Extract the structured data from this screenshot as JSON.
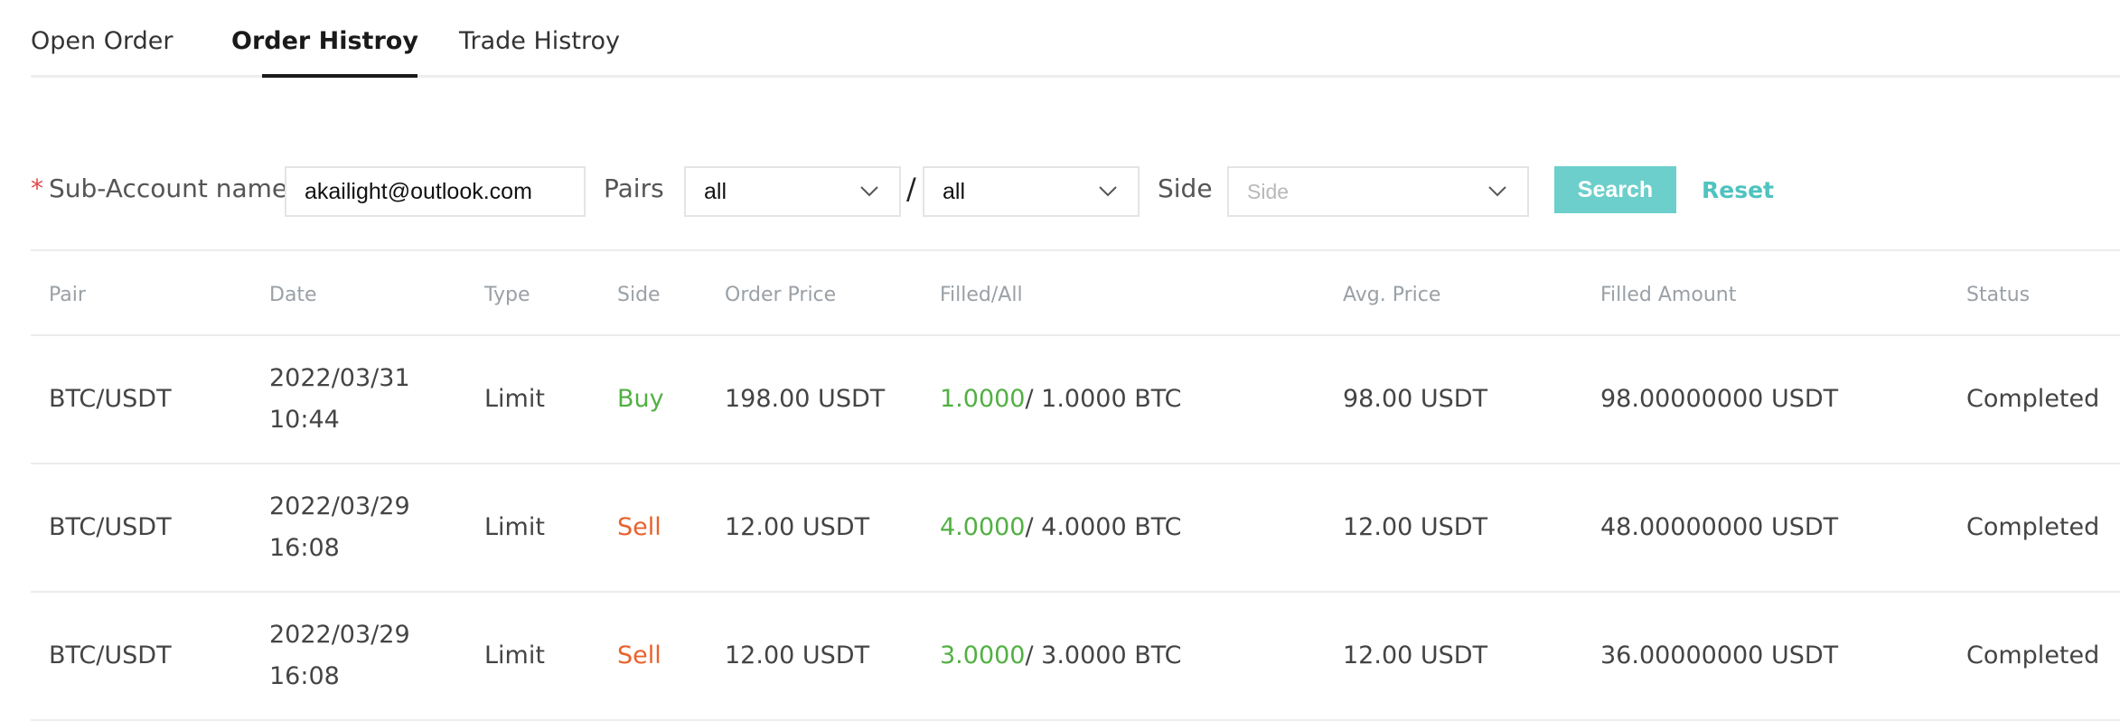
{
  "tabs": [
    {
      "label": "Open Order"
    },
    {
      "label": "Order Histroy"
    },
    {
      "label": "Trade Histroy"
    }
  ],
  "filter": {
    "required_mark": "*",
    "sub_account_label": "Sub-Account name",
    "sub_account_value": "akailight@outlook.com",
    "pairs_label": "Pairs",
    "pair_base_value": "all",
    "separator": "/",
    "pair_quote_value": "all",
    "side_label": "Side",
    "side_placeholder": "Side",
    "search_label": "Search",
    "reset_label": "Reset"
  },
  "table": {
    "headers": [
      "Pair",
      "Date",
      "Type",
      "Side",
      "Order Price",
      "Filled/All",
      "Avg. Price",
      "Filled Amount",
      "Status"
    ],
    "rows": [
      {
        "pair": "BTC/USDT",
        "date": "2022/03/31",
        "time": "10:44",
        "type": "Limit",
        "side": "Buy",
        "order_price": "198.00 USDT",
        "filled": "1.0000",
        "all": "/ 1.0000 BTC",
        "avg_price": "98.00 USDT",
        "filled_amount": "98.00000000 USDT",
        "status": "Completed"
      },
      {
        "pair": "BTC/USDT",
        "date": "2022/03/29",
        "time": "16:08",
        "type": "Limit",
        "side": "Sell",
        "order_price": "12.00 USDT",
        "filled": "4.0000",
        "all": "/ 4.0000 BTC",
        "avg_price": "12.00 USDT",
        "filled_amount": "48.00000000 USDT",
        "status": "Completed"
      },
      {
        "pair": "BTC/USDT",
        "date": "2022/03/29",
        "time": "16:08",
        "type": "Limit",
        "side": "Sell",
        "order_price": "12.00 USDT",
        "filled": "3.0000",
        "all": "/ 3.0000 BTC",
        "avg_price": "12.00 USDT",
        "filled_amount": "36.00000000 USDT",
        "status": "Completed"
      }
    ]
  },
  "colors": {
    "accent": "#6ccfcb",
    "buy": "#52b043",
    "sell": "#e8622c",
    "required": "#e5484d"
  },
  "icons": {
    "dropdown": "chevron-down-icon"
  }
}
